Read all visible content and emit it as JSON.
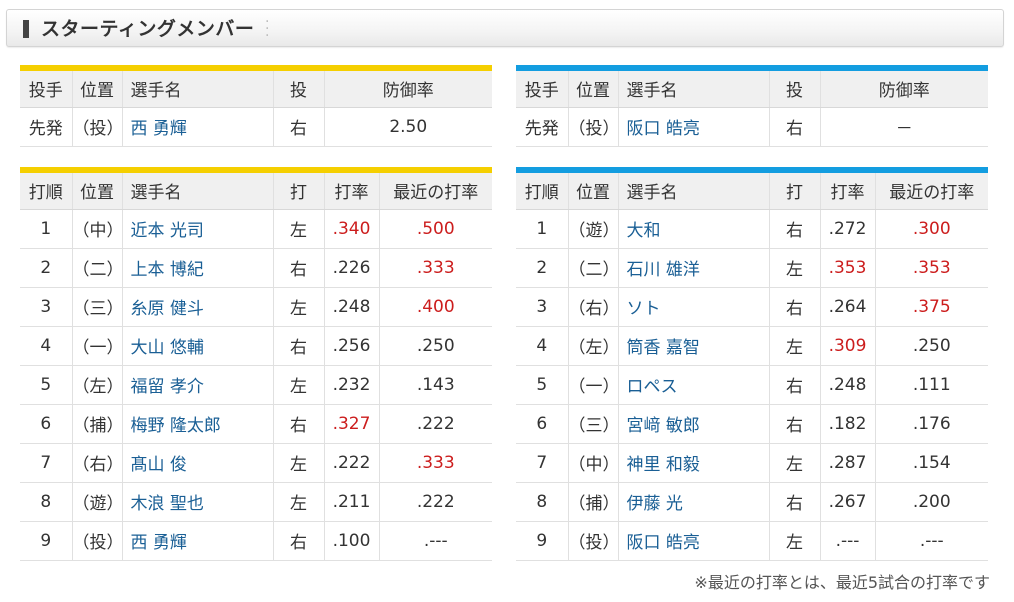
{
  "header": {
    "title": "スターティングメンバー"
  },
  "colors": {
    "home_accent": "#f5cf00",
    "away_accent": "#139de0",
    "highlight": "#cc1d1d"
  },
  "pitcher_headers": [
    "投手",
    "位置",
    "選手名",
    "投",
    "防御率"
  ],
  "home_pitcher": {
    "role": "先発",
    "pos": "（投）",
    "name": "西 勇輝",
    "throws": "右",
    "era": "2.50"
  },
  "away_pitcher": {
    "role": "先発",
    "pos": "（投）",
    "name": "阪口 皓亮",
    "throws": "右",
    "era": "－"
  },
  "batting_headers": [
    "打順",
    "位置",
    "選手名",
    "打",
    "打率",
    "最近の打率"
  ],
  "home_batters": [
    {
      "order": "1",
      "pos": "（中）",
      "name": "近本 光司",
      "bats": "左",
      "avg": ".340",
      "avg_hi": true,
      "recent": ".500",
      "recent_hi": true
    },
    {
      "order": "2",
      "pos": "（二）",
      "name": "上本 博紀",
      "bats": "右",
      "avg": ".226",
      "avg_hi": false,
      "recent": ".333",
      "recent_hi": true
    },
    {
      "order": "3",
      "pos": "（三）",
      "name": "糸原 健斗",
      "bats": "左",
      "avg": ".248",
      "avg_hi": false,
      "recent": ".400",
      "recent_hi": true
    },
    {
      "order": "4",
      "pos": "（一）",
      "name": "大山 悠輔",
      "bats": "右",
      "avg": ".256",
      "avg_hi": false,
      "recent": ".250",
      "recent_hi": false
    },
    {
      "order": "5",
      "pos": "（左）",
      "name": "福留 孝介",
      "bats": "左",
      "avg": ".232",
      "avg_hi": false,
      "recent": ".143",
      "recent_hi": false
    },
    {
      "order": "6",
      "pos": "（捕）",
      "name": "梅野 隆太郎",
      "bats": "右",
      "avg": ".327",
      "avg_hi": true,
      "recent": ".222",
      "recent_hi": false
    },
    {
      "order": "7",
      "pos": "（右）",
      "name": "髙山 俊",
      "bats": "左",
      "avg": ".222",
      "avg_hi": false,
      "recent": ".333",
      "recent_hi": true
    },
    {
      "order": "8",
      "pos": "（遊）",
      "name": "木浪 聖也",
      "bats": "左",
      "avg": ".211",
      "avg_hi": false,
      "recent": ".222",
      "recent_hi": false
    },
    {
      "order": "9",
      "pos": "（投）",
      "name": "西 勇輝",
      "bats": "右",
      "avg": ".100",
      "avg_hi": false,
      "recent": ".---",
      "recent_hi": false
    }
  ],
  "away_batters": [
    {
      "order": "1",
      "pos": "（遊）",
      "name": "大和",
      "bats": "右",
      "avg": ".272",
      "avg_hi": false,
      "recent": ".300",
      "recent_hi": true
    },
    {
      "order": "2",
      "pos": "（二）",
      "name": "石川 雄洋",
      "bats": "左",
      "avg": ".353",
      "avg_hi": true,
      "recent": ".353",
      "recent_hi": true
    },
    {
      "order": "3",
      "pos": "（右）",
      "name": "ソト",
      "bats": "右",
      "avg": ".264",
      "avg_hi": false,
      "recent": ".375",
      "recent_hi": true
    },
    {
      "order": "4",
      "pos": "（左）",
      "name": "筒香 嘉智",
      "bats": "左",
      "avg": ".309",
      "avg_hi": true,
      "recent": ".250",
      "recent_hi": false
    },
    {
      "order": "5",
      "pos": "（一）",
      "name": "ロペス",
      "bats": "右",
      "avg": ".248",
      "avg_hi": false,
      "recent": ".111",
      "recent_hi": false
    },
    {
      "order": "6",
      "pos": "（三）",
      "name": "宮﨑 敏郎",
      "bats": "右",
      "avg": ".182",
      "avg_hi": false,
      "recent": ".176",
      "recent_hi": false
    },
    {
      "order": "7",
      "pos": "（中）",
      "name": "神里 和毅",
      "bats": "左",
      "avg": ".287",
      "avg_hi": false,
      "recent": ".154",
      "recent_hi": false
    },
    {
      "order": "8",
      "pos": "（捕）",
      "name": "伊藤 光",
      "bats": "右",
      "avg": ".267",
      "avg_hi": false,
      "recent": ".200",
      "recent_hi": false
    },
    {
      "order": "9",
      "pos": "（投）",
      "name": "阪口 皓亮",
      "bats": "左",
      "avg": ".---",
      "avg_hi": false,
      "recent": ".---",
      "recent_hi": false
    }
  ],
  "footnote": "※最近の打率とは、最近5試合の打率です"
}
